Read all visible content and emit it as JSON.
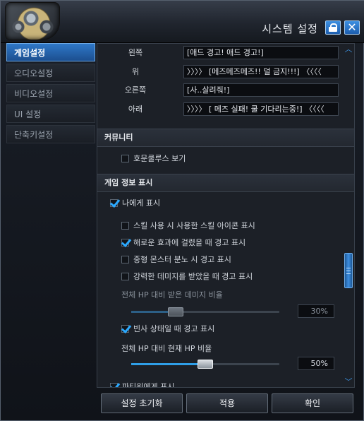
{
  "window": {
    "title": "시스템 설정"
  },
  "sidebar": {
    "items": [
      {
        "label": "게임설정"
      },
      {
        "label": "오디오설정"
      },
      {
        "label": "비디오설정"
      },
      {
        "label": "UI 설정"
      },
      {
        "label": "단축키설정"
      }
    ]
  },
  "directions": [
    {
      "label": "왼쪽",
      "value": "[애드 경고! 애드 경고!]"
    },
    {
      "label": "위",
      "value": "〉〉〉〉 [메즈메즈메즈!!  덜 금지!!!] 〈〈〈〈"
    },
    {
      "label": "오른쪽",
      "value": "[사..살려줘!]"
    },
    {
      "label": "아래",
      "value": "〉〉〉〉 [ 메즈 실패! 쿨 기다리는중!] 〈〈〈〈"
    }
  ],
  "community": {
    "header": "커뮤니티",
    "show_option": "호문쿨루스 보기"
  },
  "game_info": {
    "header": "게임 정보 표시",
    "show_me": "나에게 표시",
    "skill_icon": "스킬 사용 시 사용한 스킬 아이콘 표시",
    "harmful_effect": "해로운 효과에 걸렸을 때 경고 표시",
    "monster_rage": "중형 몬스터 분노 시 경고 표시",
    "strong_damage": "강력한 데미지를 받았을 때 경고 표시",
    "damage_ratio_label": "전체 HP 대비 받은 데미지 비율",
    "damage_ratio_value": "30%",
    "damage_ratio_level": 0.3,
    "dying_warning": "빈사 상태일 때 경고 표시",
    "hp_ratio_label": "전체 HP 대비 현재 HP 비율",
    "hp_ratio_value": "50%",
    "hp_ratio_level": 0.5,
    "show_party": "파티원에게 표시"
  },
  "footer": {
    "reset": "설정 초기화",
    "apply": "적용",
    "confirm": "확인"
  },
  "colors": {
    "accent": "#2f9fe8",
    "active_tab": "#2f78c8"
  }
}
